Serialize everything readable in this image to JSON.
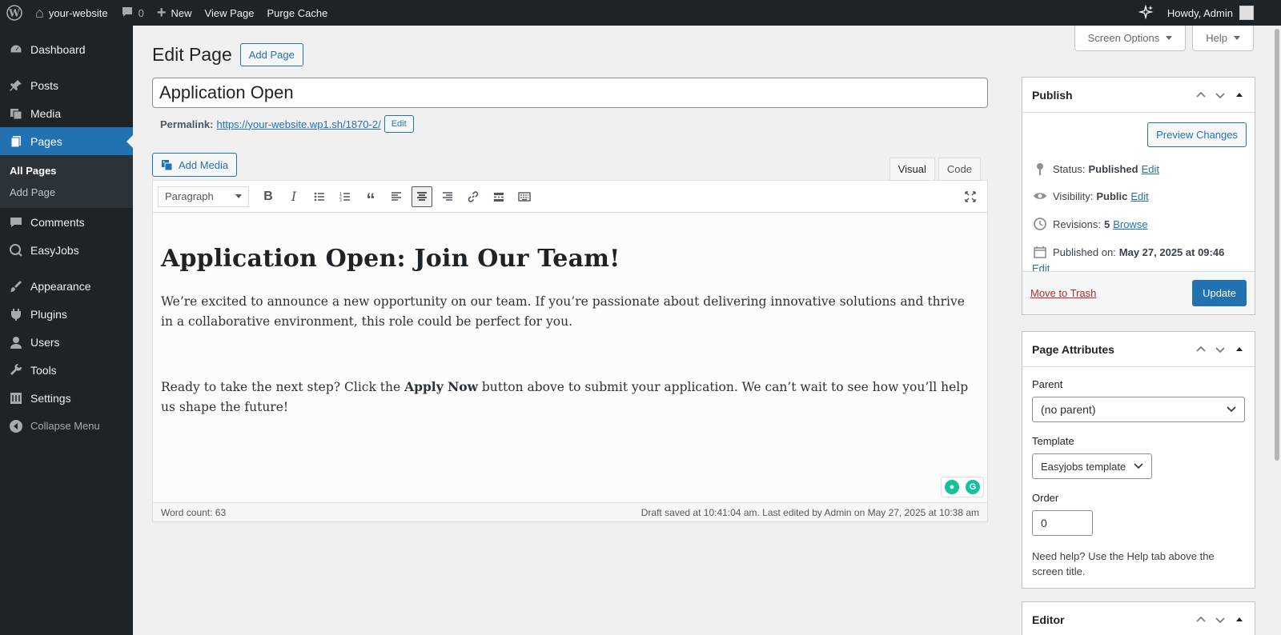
{
  "admin_bar": {
    "site_name": "your-website",
    "comments_count": "0",
    "new_label": "New",
    "view_page_label": "View Page",
    "purge_cache_label": "Purge Cache",
    "howdy_label": "Howdy, Admin"
  },
  "sidebar": {
    "items": [
      {
        "label": "Dashboard",
        "icon": "dashboard-icon"
      },
      {
        "label": "Posts",
        "icon": "pin-icon"
      },
      {
        "label": "Media",
        "icon": "media-icon"
      },
      {
        "label": "Pages",
        "icon": "pages-icon"
      },
      {
        "label": "Comments",
        "icon": "comment-icon"
      },
      {
        "label": "EasyJobs",
        "icon": "easyjobs-icon"
      },
      {
        "label": "Appearance",
        "icon": "brush-icon"
      },
      {
        "label": "Plugins",
        "icon": "plug-icon"
      },
      {
        "label": "Users",
        "icon": "user-icon"
      },
      {
        "label": "Tools",
        "icon": "wrench-icon"
      },
      {
        "label": "Settings",
        "icon": "settings-icon"
      },
      {
        "label": "Collapse Menu",
        "icon": "collapse-icon"
      }
    ],
    "submenu": {
      "all_pages": "All Pages",
      "add_page": "Add Page"
    }
  },
  "header": {
    "screen_options": "Screen Options",
    "help": "Help",
    "page_title": "Edit Page",
    "add_page_button": "Add Page"
  },
  "post": {
    "title": "Application Open",
    "permalink_label": "Permalink:",
    "permalink_url": "https://your-website.wp1.sh/1870-2/",
    "permalink_edit": "Edit"
  },
  "editor": {
    "add_media": "Add Media",
    "tab_visual": "Visual",
    "tab_code": "Code",
    "format_select": "Paragraph",
    "heading": "Application Open: Join Our Team!",
    "para1": "We’re excited to announce a new opportunity on our team. If you’re passionate about delivering innovative solutions and thrive in a collaborative environment, this role could be perfect for you.",
    "para2_before": "Ready to take the next step? Click the ",
    "para2_bold": "Apply Now",
    "para2_after": " button above to submit your application. We can’t wait to see how you’ll help us shape the future!",
    "word_count": "Word count: 63",
    "draft_saved": "Draft saved at 10:41:04 am. Last edited by Admin on May 27, 2025 at 10:38 am"
  },
  "publish": {
    "title": "Publish",
    "preview_button": "Preview Changes",
    "status_label": "Status:",
    "status_value": "Published",
    "visibility_label": "Visibility:",
    "visibility_value": "Public",
    "revisions_label": "Revisions:",
    "revisions_value": "5",
    "browse": "Browse",
    "published_on_label": "Published on:",
    "published_on_value": "May 27, 2025 at 09:46",
    "edit": "Edit",
    "trash": "Move to Trash",
    "update": "Update"
  },
  "page_attributes": {
    "title": "Page Attributes",
    "parent_label": "Parent",
    "parent_value": "(no parent)",
    "template_label": "Template",
    "template_value": "Easyjobs template",
    "order_label": "Order",
    "order_value": "0",
    "help_text": "Need help? Use the Help tab above the screen title."
  },
  "editor_box": {
    "title": "Editor"
  },
  "colors": {
    "accent": "#2271b1",
    "admin_bg": "#1d2327"
  }
}
